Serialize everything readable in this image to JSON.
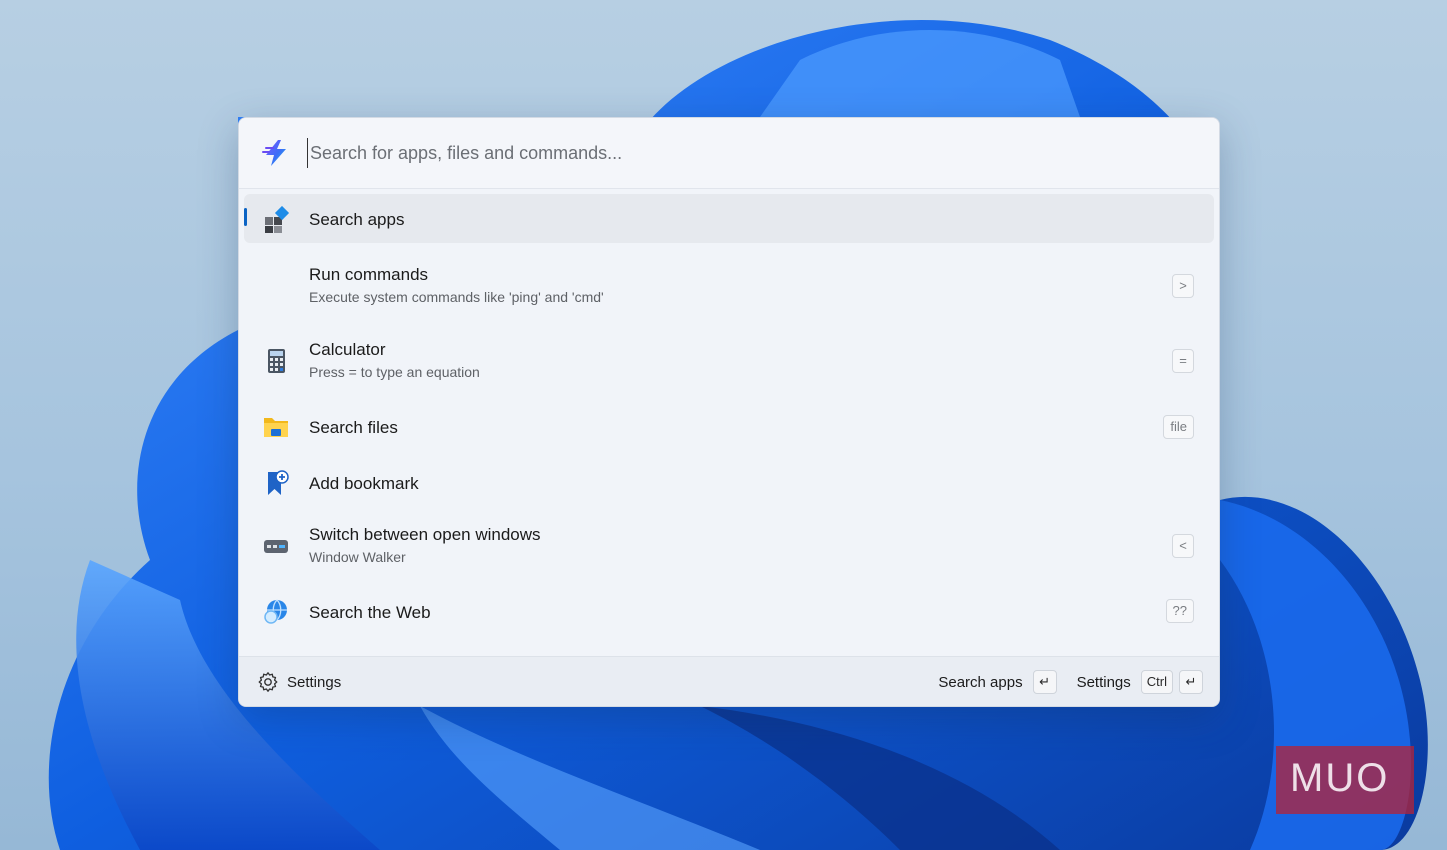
{
  "search": {
    "placeholder": "Search for apps, files and commands..."
  },
  "results": [
    {
      "icon": "apps-icon",
      "title": "Search apps",
      "subtitle": "",
      "shortcut": "",
      "selected": true
    },
    {
      "icon": "",
      "title": "Run commands",
      "subtitle": "Execute system commands like 'ping' and 'cmd'",
      "shortcut": ">",
      "selected": false
    },
    {
      "icon": "calculator-icon",
      "title": "Calculator",
      "subtitle": "Press = to type an equation",
      "shortcut": "=",
      "selected": false
    },
    {
      "icon": "folder-icon",
      "title": "Search files",
      "subtitle": "",
      "shortcut": "file",
      "selected": false
    },
    {
      "icon": "bookmark-add-icon",
      "title": "Add bookmark",
      "subtitle": "",
      "shortcut": "",
      "selected": false
    },
    {
      "icon": "window-walker-icon",
      "title": "Switch between open windows",
      "subtitle": "Window Walker",
      "shortcut": "<",
      "selected": false
    },
    {
      "icon": "globe-search-icon",
      "title": "Search the Web",
      "subtitle": "",
      "shortcut": "??",
      "selected": false
    }
  ],
  "footer": {
    "settings_label": "Settings",
    "action_label": "Search apps",
    "action_key": "↵",
    "settings_action_label": "Settings",
    "settings_key_modifier": "Ctrl",
    "settings_key": "↵"
  },
  "watermark": {
    "text": "MUO"
  },
  "colors": {
    "accent": "#0a63c4",
    "panel": "#f1f4f9",
    "watermark": "#b42337"
  }
}
